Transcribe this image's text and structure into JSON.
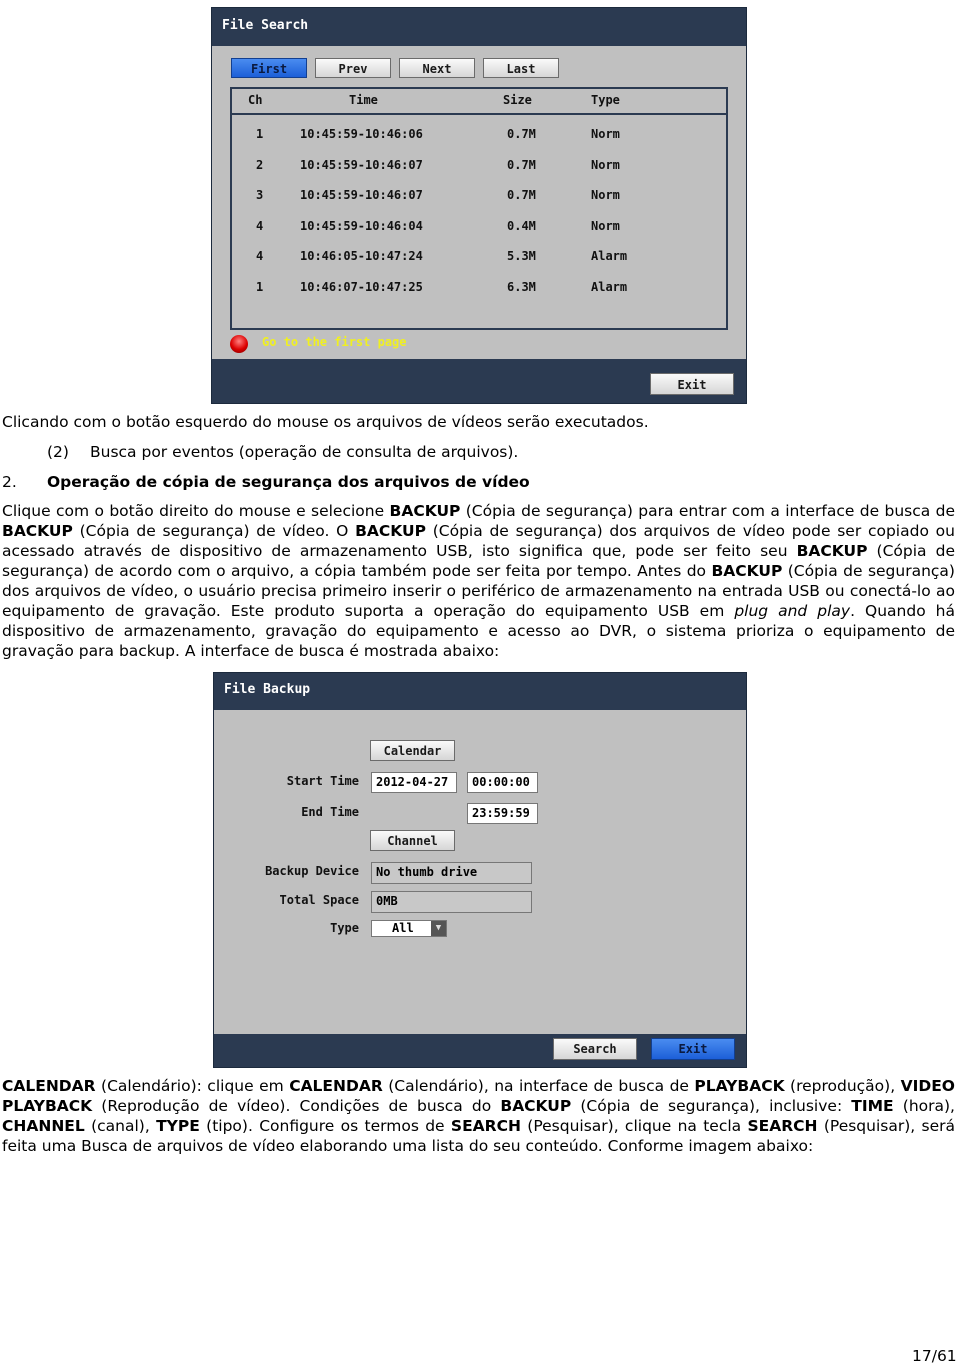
{
  "file_search": {
    "title": "File Search",
    "buttons": {
      "first": "First",
      "prev": "Prev",
      "next": "Next",
      "last": "Last"
    },
    "columns": [
      "Ch",
      "Time",
      "Size",
      "Type"
    ],
    "rows": [
      [
        "1",
        "10:45:59-10:46:06",
        "0.7M",
        "Norm"
      ],
      [
        "2",
        "10:45:59-10:46:07",
        "0.7M",
        "Norm"
      ],
      [
        "3",
        "10:45:59-10:46:07",
        "0.7M",
        "Norm"
      ],
      [
        "4",
        "10:45:59-10:46:04",
        "0.4M",
        "Norm"
      ],
      [
        "4",
        "10:46:05-10:47:24",
        "5.3M",
        "Alarm"
      ],
      [
        "1",
        "10:46:07-10:47:25",
        "6.3M",
        "Alarm"
      ]
    ],
    "status": "Go to the first page",
    "exit": "Exit",
    "colors": {
      "header": "#2b3a51",
      "panel": "#c0c0c0",
      "status_text": "#f0f020",
      "active_button": "#2a6ee0"
    }
  },
  "doc1": {
    "caption": "Clicando com o botão esquerdo do mouse os arquivos de vídeos serão executados.",
    "item_num": "(2)",
    "item_text": "Busca por eventos (operação de consulta de arquivos).",
    "section_num": "2.",
    "section_title": "Operação de cópia de segurança dos arquivos de vídeo",
    "paragraph": [
      {
        "t": "Clique com o botão direito do mouse e selecione "
      },
      {
        "t": "BACKUP",
        "b": true
      },
      {
        "t": " (Cópia de segurança) para entrar com a interface de busca de "
      },
      {
        "t": "BACKUP",
        "b": true
      },
      {
        "t": " (Cópia de segurança) de vídeo. O "
      },
      {
        "t": "BACKUP",
        "b": true
      },
      {
        "t": " (Cópia de segurança) dos arquivos de vídeo pode ser copiado ou acessado através de dispositivo de armazenamento USB, isto significa que, pode ser feito seu "
      },
      {
        "t": "BACKUP",
        "b": true
      },
      {
        "t": " (Cópia de segurança) de acordo com o arquivo, a cópia também pode ser feita por tempo. Antes do "
      },
      {
        "t": "BACKUP",
        "b": true
      },
      {
        "t": " (Cópia de segurança) dos arquivos de vídeo, o usuário precisa primeiro inserir o periférico de armazenamento na entrada USB ou conectá-lo ao equipamento de gravação. Este produto suporta a operação do equipamento USB em "
      },
      {
        "t": "plug and play",
        "i": true
      },
      {
        "t": ". Quando há dispositivo de armazenamento, gravação do equipamento e acesso ao DVR, o sistema prioriza o equipamento de gravação para backup. A interface de busca é mostrada abaixo:"
      }
    ]
  },
  "file_backup": {
    "title": "File Backup",
    "calendar": "Calendar",
    "start_label": "Start Time",
    "start_date": "2012-04-27",
    "start_time": "00:00:00",
    "end_label": "End Time",
    "end_time": "23:59:59",
    "channel": "Channel",
    "device_label": "Backup Device",
    "device_value": "No thumb drive",
    "space_label": "Total Space",
    "space_value": "0MB",
    "type_label": "Type",
    "type_value": "All",
    "search": "Search",
    "exit": "Exit"
  },
  "doc2": {
    "paragraph": [
      {
        "t": "CALENDAR",
        "b": true
      },
      {
        "t": " (Calendário): clique em "
      },
      {
        "t": "CALENDAR",
        "b": true
      },
      {
        "t": " (Calendário), na interface de busca de "
      },
      {
        "t": "PLAYBACK",
        "b": true
      },
      {
        "t": " (reprodução), "
      },
      {
        "t": "VIDEO PLAYBACK",
        "b": true
      },
      {
        "t": " (Reprodução de vídeo). Condições de busca do "
      },
      {
        "t": "BACKUP",
        "b": true
      },
      {
        "t": " (Cópia de segurança), inclusive: "
      },
      {
        "t": "TIME",
        "b": true
      },
      {
        "t": " (hora), "
      },
      {
        "t": "CHANNEL",
        "b": true
      },
      {
        "t": " (canal), "
      },
      {
        "t": "TYPE",
        "b": true
      },
      {
        "t": " (tipo). Configure os termos de "
      },
      {
        "t": "SEARCH",
        "b": true
      },
      {
        "t": " (Pesquisar), clique na tecla "
      },
      {
        "t": "SEARCH",
        "b": true
      },
      {
        "t": " (Pesquisar), será feita uma Busca de arquivos de vídeo elaborando uma lista do seu conteúdo. Conforme imagem abaixo:"
      }
    ]
  },
  "page_number": "17/61"
}
